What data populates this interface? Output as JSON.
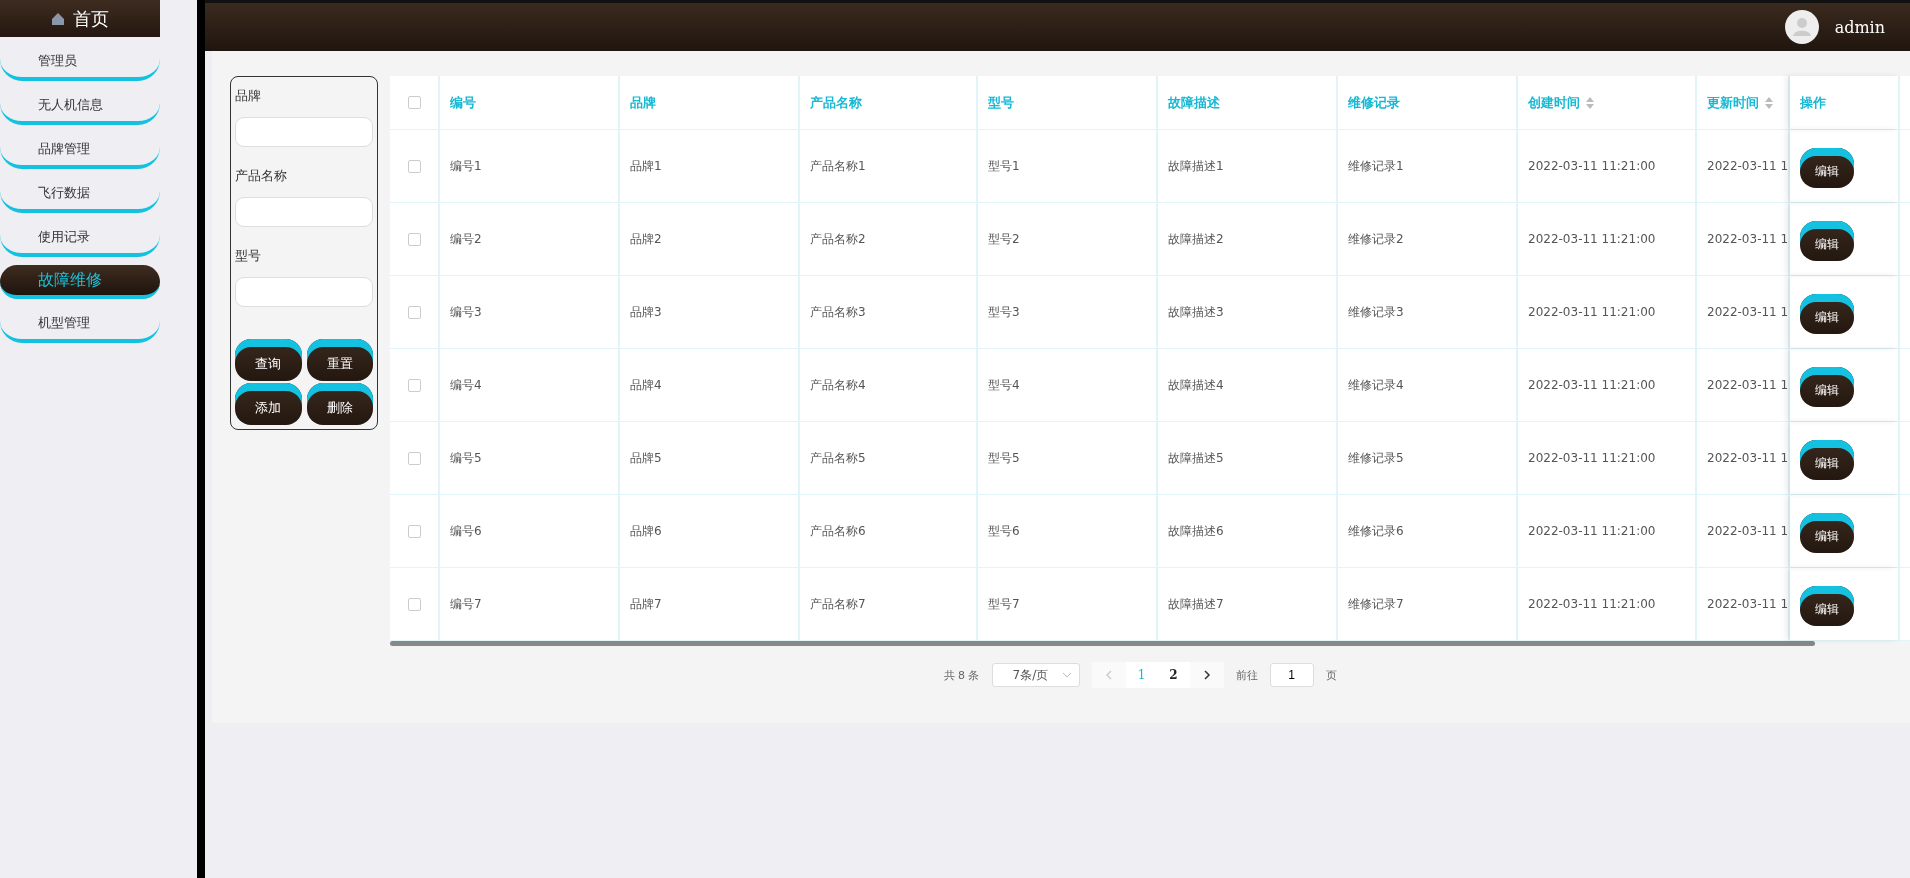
{
  "sidebar": {
    "home": "首页",
    "items": [
      {
        "label": "管理员",
        "selected": false
      },
      {
        "label": "无人机信息",
        "selected": false
      },
      {
        "label": "品牌管理",
        "selected": false
      },
      {
        "label": "飞行数据",
        "selected": false
      },
      {
        "label": "使用记录",
        "selected": false
      },
      {
        "label": "故障维修",
        "selected": true
      },
      {
        "label": "机型管理",
        "selected": false
      }
    ]
  },
  "header": {
    "user": "admin"
  },
  "filters": {
    "fields": [
      {
        "label": "品牌"
      },
      {
        "label": "产品名称"
      },
      {
        "label": "型号"
      }
    ],
    "buttons": [
      "查询",
      "重置",
      "添加",
      "删除"
    ]
  },
  "table": {
    "select_all": {
      "checked": false
    },
    "columns": [
      {
        "label": "编号",
        "sortable": false
      },
      {
        "label": "品牌",
        "sortable": false
      },
      {
        "label": "产品名称",
        "sortable": false
      },
      {
        "label": "型号",
        "sortable": false
      },
      {
        "label": "故障描述",
        "sortable": false
      },
      {
        "label": "维修记录",
        "sortable": false
      },
      {
        "label": "创建时间",
        "sortable": true
      },
      {
        "label": "更新时间",
        "sortable": true
      },
      {
        "label": "操作",
        "sortable": false
      }
    ],
    "rows": [
      {
        "checked": false,
        "cells": [
          "编号1",
          "品牌1",
          "产品名称1",
          "型号1",
          "故障描述1",
          "维修记录1",
          "2022-03-11 11:21:00",
          "2022-03-11 1"
        ],
        "action": "编辑"
      },
      {
        "checked": false,
        "cells": [
          "编号2",
          "品牌2",
          "产品名称2",
          "型号2",
          "故障描述2",
          "维修记录2",
          "2022-03-11 11:21:00",
          "2022-03-11 1"
        ],
        "action": "编辑"
      },
      {
        "checked": false,
        "cells": [
          "编号3",
          "品牌3",
          "产品名称3",
          "型号3",
          "故障描述3",
          "维修记录3",
          "2022-03-11 11:21:00",
          "2022-03-11 1"
        ],
        "action": "编辑"
      },
      {
        "checked": false,
        "cells": [
          "编号4",
          "品牌4",
          "产品名称4",
          "型号4",
          "故障描述4",
          "维修记录4",
          "2022-03-11 11:21:00",
          "2022-03-11 1"
        ],
        "action": "编辑"
      },
      {
        "checked": false,
        "cells": [
          "编号5",
          "品牌5",
          "产品名称5",
          "型号5",
          "故障描述5",
          "维修记录5",
          "2022-03-11 11:21:00",
          "2022-03-11 1"
        ],
        "action": "编辑"
      },
      {
        "checked": false,
        "cells": [
          "编号6",
          "品牌6",
          "产品名称6",
          "型号6",
          "故障描述6",
          "维修记录6",
          "2022-03-11 11:21:00",
          "2022-03-11 1"
        ],
        "action": "编辑"
      },
      {
        "checked": false,
        "cells": [
          "编号7",
          "品牌7",
          "产品名称7",
          "型号7",
          "故障描述7",
          "维修记录7",
          "2022-03-11 11:21:00",
          "2022-03-11 1"
        ],
        "action": "编辑"
      }
    ]
  },
  "pagination": {
    "total": "共 8 条",
    "page_size": "7条/页",
    "pages": [
      {
        "label": "1",
        "selected": true
      },
      {
        "label": "2",
        "selected": false
      }
    ],
    "goto_label": "前往",
    "goto_value": "1",
    "page_unit": "页"
  }
}
